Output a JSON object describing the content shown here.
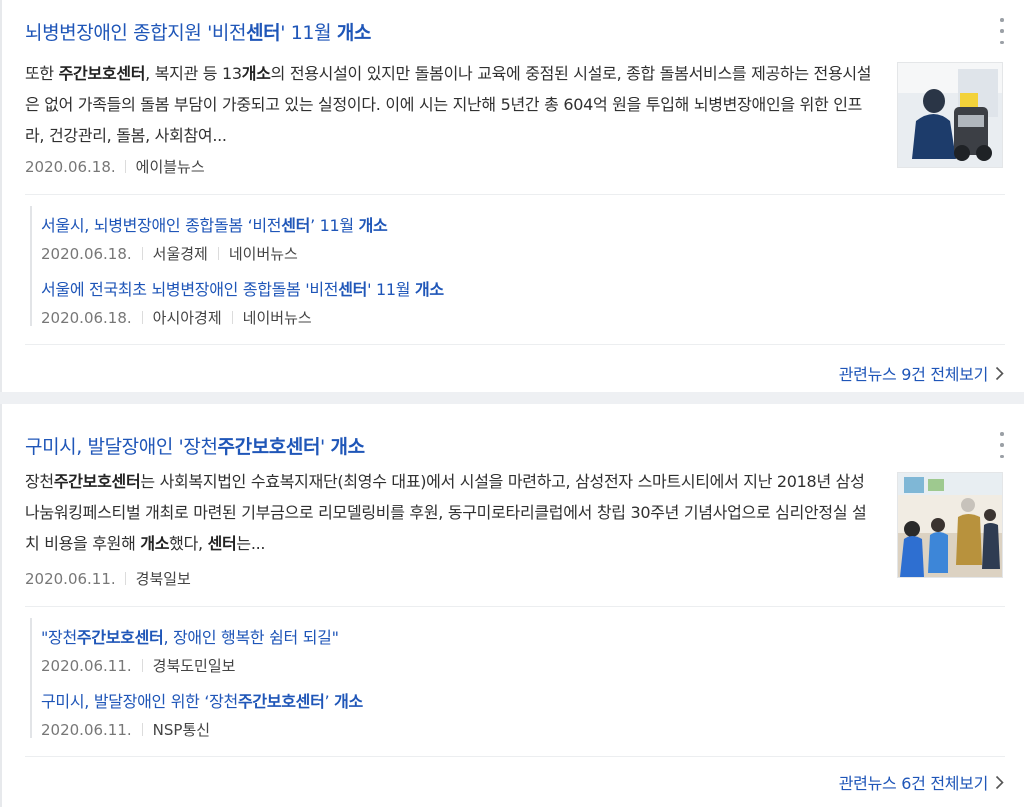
{
  "articles": [
    {
      "title_parts": [
        {
          "t": "뇌병변장애인 종합지원 '비전",
          "b": false
        },
        {
          "t": "센터",
          "b": true
        },
        {
          "t": "' 11월 ",
          "b": false
        },
        {
          "t": "개소",
          "b": true
        }
      ],
      "desc_parts": [
        {
          "t": "또한 ",
          "b": false
        },
        {
          "t": "주간보호센터",
          "b": true
        },
        {
          "t": ", 복지관 등 13",
          "b": false
        },
        {
          "t": "개소",
          "b": true
        },
        {
          "t": "의 전용시설이 있지만 돌봄이나 교육에 중점된 시설로, 종합 돌봄서비스를 제공하는 전용시설은 없어 가족들의 돌봄 부담이 가중되고 있는 실정이다. 이에 시는 지난해 5년간 총 604억 원을 투입해 뇌병변장애인을 위한 인프라, 건강관리, 돌봄, 사회참여...",
          "b": false
        }
      ],
      "date": "2020.06.18.",
      "source": "에이블뉴스",
      "related": [
        {
          "title_parts": [
            {
              "t": "서울시, 뇌병변장애인 종합돌봄 ‘비전",
              "b": false
            },
            {
              "t": "센터",
              "b": true
            },
            {
              "t": "’ 11월 ",
              "b": false
            },
            {
              "t": "개소",
              "b": true
            }
          ],
          "date": "2020.06.18.",
          "source": "서울경제",
          "portal": "네이버뉴스"
        },
        {
          "title_parts": [
            {
              "t": "서울에 전국최초 뇌병변장애인 종합돌봄 '비전",
              "b": false
            },
            {
              "t": "센터",
              "b": true
            },
            {
              "t": "' 11월 ",
              "b": false
            },
            {
              "t": "개소",
              "b": true
            }
          ],
          "date": "2020.06.18.",
          "source": "아시아경제",
          "portal": "네이버뉴스"
        }
      ],
      "more_label": "관련뉴스 9건 전체보기"
    },
    {
      "title_parts": [
        {
          "t": "구미시, 발달장애인 '장천",
          "b": false
        },
        {
          "t": "주간보호센터",
          "b": true
        },
        {
          "t": "' ",
          "b": false
        },
        {
          "t": "개소",
          "b": true
        }
      ],
      "desc_parts": [
        {
          "t": "장천",
          "b": false
        },
        {
          "t": "주간보호센터",
          "b": true
        },
        {
          "t": "는 사회복지법인 수효복지재단(최영수 대표)에서 시설을 마련하고, 삼성전자 스마트시티에서 지난 2018년 삼성나눔워킹페스티벌 개최로 마련된 기부금으로 리모델링비를 후원, 동구미로타리클럽에서 창립 30주년 기념사업으로 심리안정실 설치 비용을 후원해 ",
          "b": false
        },
        {
          "t": "개소",
          "b": true
        },
        {
          "t": "했다, ",
          "b": false
        },
        {
          "t": "센터",
          "b": true
        },
        {
          "t": "는...",
          "b": false
        }
      ],
      "date": "2020.06.11.",
      "source": "경북일보",
      "related": [
        {
          "title_parts": [
            {
              "t": "\"장천",
              "b": false
            },
            {
              "t": "주간보호센터",
              "b": true
            },
            {
              "t": ", 장애인 행복한 쉼터 되길\"",
              "b": false
            }
          ],
          "date": "2020.06.11.",
          "source": "경북도민일보",
          "portal": ""
        },
        {
          "title_parts": [
            {
              "t": "구미시, 발달장애인 위한 ‘장천",
              "b": false
            },
            {
              "t": "주간보호센터",
              "b": true
            },
            {
              "t": "’ ",
              "b": false
            },
            {
              "t": "개소",
              "b": true
            }
          ],
          "date": "2020.06.11.",
          "source": "NSP통신",
          "portal": ""
        }
      ],
      "more_label": "관련뉴스 6건 전체보기"
    }
  ],
  "colors": {
    "link": "#1f56b8",
    "meta": "#777777",
    "background": "#eef0f3"
  },
  "icons": {
    "menu": "more-vertical-icon",
    "chevron": "chevron-right-icon"
  }
}
